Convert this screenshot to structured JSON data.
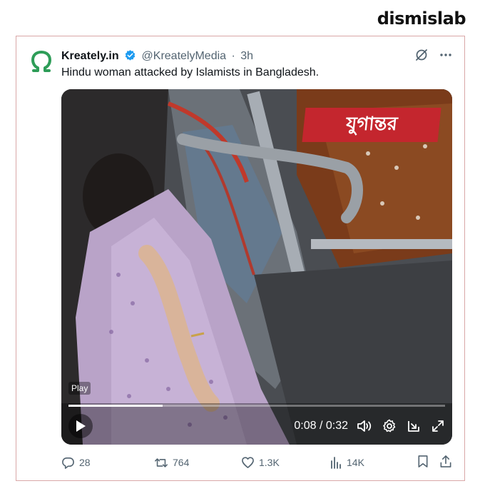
{
  "brand": "dismislab",
  "tweet": {
    "display_name": "Kreately.in",
    "handle": "@KreatelyMedia",
    "separator": "·",
    "time": "3h",
    "text": "Hindu woman attacked by Islamists in Bangladesh."
  },
  "media": {
    "overlay_logo": "যুগান্তর",
    "play_label": "Play",
    "current_time": "0:08",
    "duration": "0:32",
    "time_display": "0:08 / 0:32",
    "progress_fraction": 0.25
  },
  "actions": {
    "replies": "28",
    "reposts": "764",
    "likes": "1.3K",
    "views": "14K"
  },
  "colors": {
    "verified": "#1d9bf0",
    "avatar": "#2e9d58",
    "news_logo_bg": "#c4262e",
    "muted": "#536471"
  },
  "icons": [
    "grok-icon",
    "more-icon",
    "verified-icon",
    "play-icon",
    "volume-icon",
    "settings-icon",
    "pip-icon",
    "fullscreen-icon",
    "reply-icon",
    "repost-icon",
    "like-icon",
    "views-icon",
    "bookmark-icon",
    "share-icon"
  ]
}
